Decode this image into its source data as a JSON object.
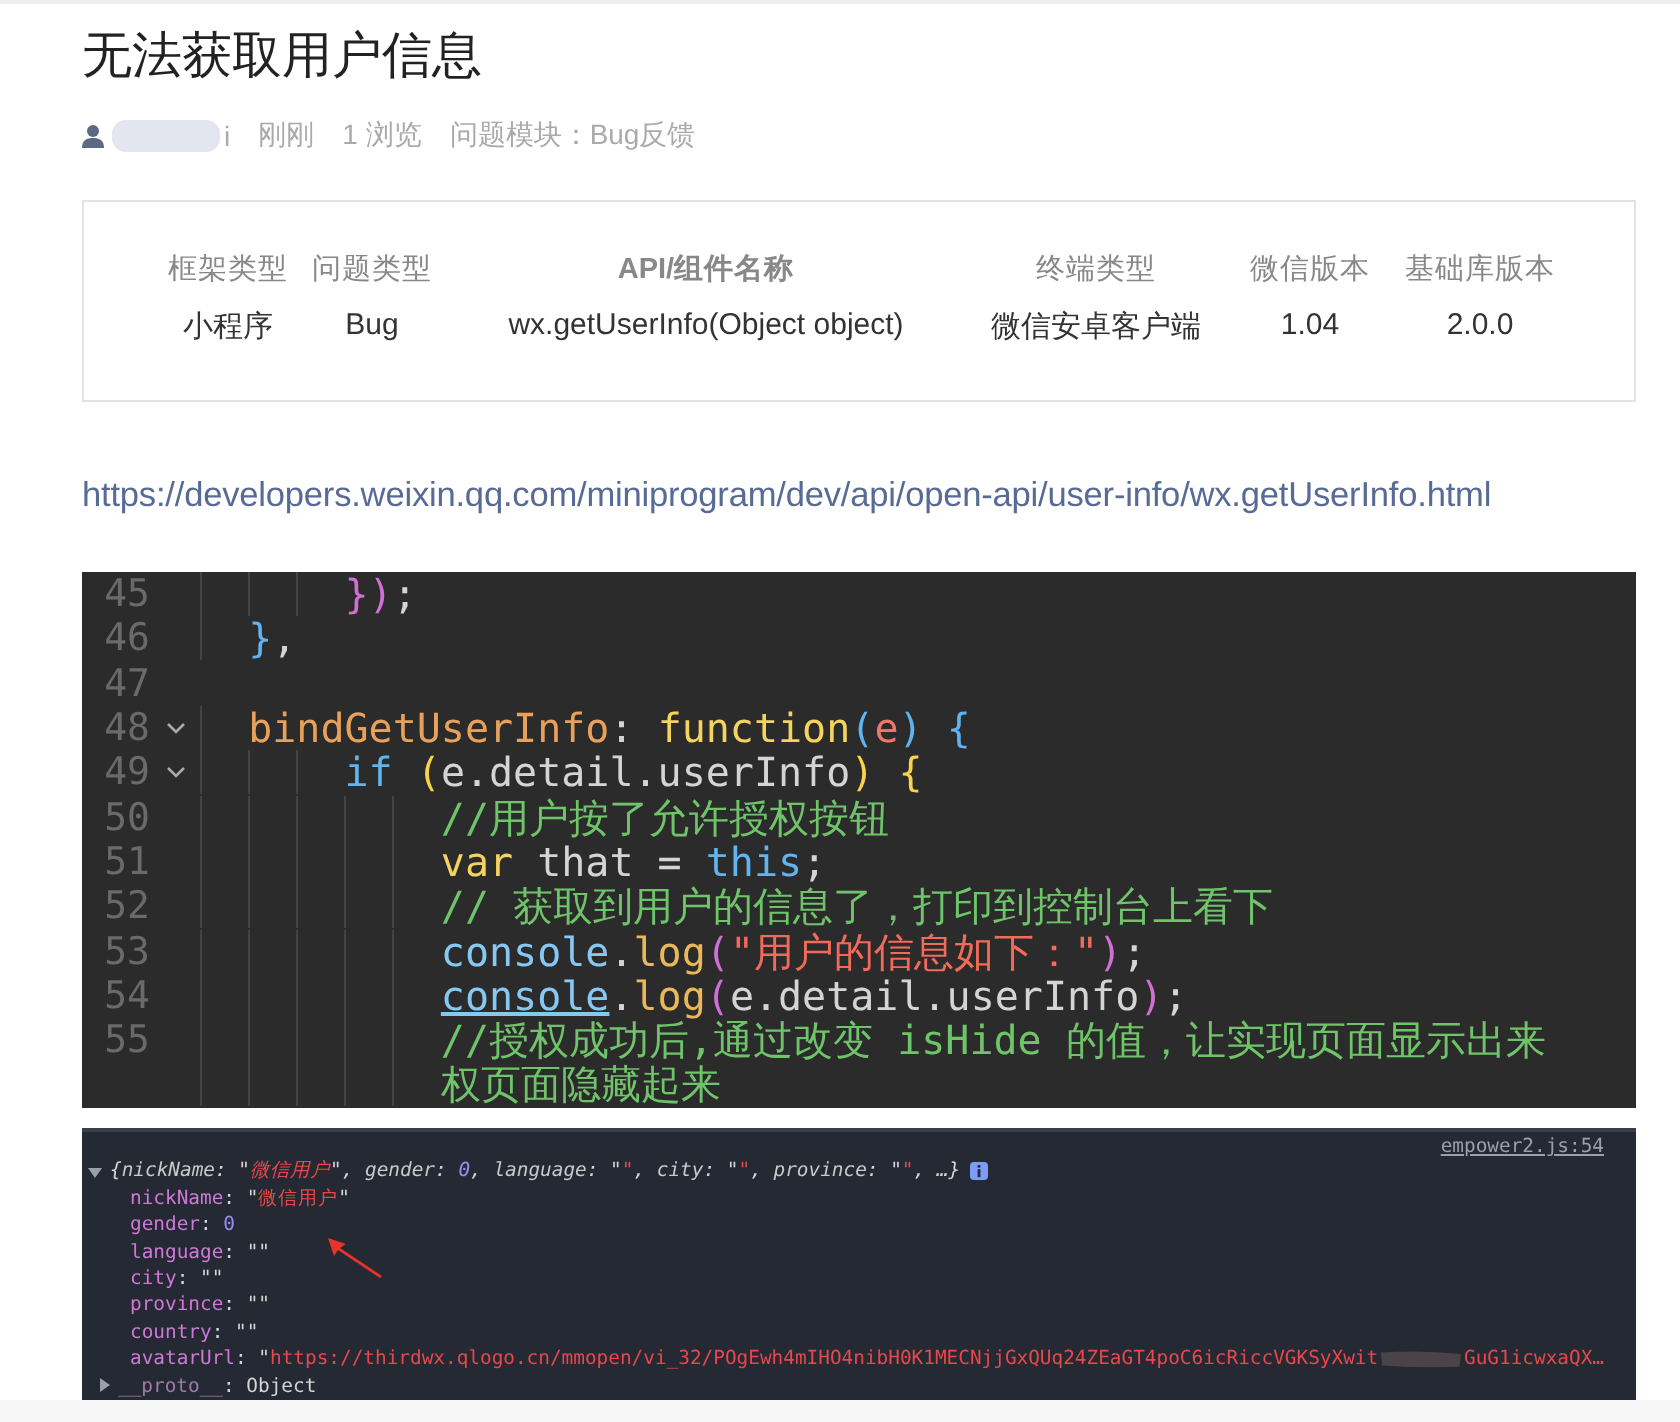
{
  "title": "无法获取用户信息",
  "meta": {
    "author": "i",
    "time": "刚刚",
    "views": "1 浏览",
    "module": "问题模块：Bug反馈"
  },
  "info_table": {
    "columns": [
      "框架类型",
      "问题类型",
      "API/组件名称",
      "终端类型",
      "微信版本",
      "基础库版本"
    ],
    "values": [
      "小程序",
      "Bug",
      "wx.getUserInfo(Object object)",
      "微信安卓客户端",
      "1.04",
      "2.0.0"
    ]
  },
  "link": "https://developers.weixin.qq.com/miniprogram/dev/api/open-api/user-info/wx.getUserInfo.html",
  "code": {
    "lines": [
      {
        "number": "45",
        "foldable": false,
        "tokens": [
          {
            "kind": "bracket3",
            "text": "      })"
          },
          {
            "kind": "plain",
            "text": ";"
          }
        ]
      },
      {
        "number": "46",
        "foldable": false,
        "tokens": [
          {
            "kind": "bracket1",
            "text": "  }"
          },
          {
            "kind": "plain",
            "text": ","
          }
        ]
      },
      {
        "number": "47",
        "foldable": false
      },
      {
        "number": "48",
        "foldable": true,
        "tokens": [
          {
            "kind": "function",
            "text": "  bindGetUserInfo"
          },
          {
            "kind": "plain",
            "text": ": "
          },
          {
            "kind": "storage",
            "text": "function"
          },
          {
            "kind": "bracket1",
            "text": "("
          },
          {
            "kind": "param",
            "text": "e"
          },
          {
            "kind": "bracket1",
            "text": ")"
          },
          {
            "kind": "bracket1",
            "text": " {"
          }
        ]
      },
      {
        "number": "49",
        "foldable": true,
        "tokens": [
          {
            "kind": "keyword",
            "text": "      if"
          },
          {
            "kind": "bracket2",
            "text": " ("
          },
          {
            "kind": "plain",
            "text": "e.detail.userInfo"
          },
          {
            "kind": "bracket2",
            "text": ")"
          },
          {
            "kind": "bracket2",
            "text": " {"
          }
        ]
      },
      {
        "number": "50",
        "foldable": false,
        "tokens": [
          {
            "kind": "comment",
            "text": "          //用户按了允许授权按钮"
          }
        ]
      },
      {
        "number": "51",
        "foldable": false,
        "tokens": [
          {
            "kind": "storage",
            "text": "          var"
          },
          {
            "kind": "plain",
            "text": " that = "
          },
          {
            "kind": "keyword",
            "text": "this"
          },
          {
            "kind": "plain",
            "text": ";"
          }
        ]
      },
      {
        "number": "52",
        "foldable": false,
        "tokens": [
          {
            "kind": "comment",
            "text": "          // 获取到用户的信息了，打印到控制台上看下"
          }
        ]
      },
      {
        "number": "53",
        "foldable": false,
        "tokens": [
          {
            "kind": "object",
            "text": "          console"
          },
          {
            "kind": "plain",
            "text": "."
          },
          {
            "kind": "method",
            "text": "log"
          },
          {
            "kind": "bracket3",
            "text": "("
          },
          {
            "kind": "string",
            "text": "\"用户的信息如下：\""
          },
          {
            "kind": "bracket3",
            "text": ")"
          },
          {
            "kind": "plain",
            "text": ";"
          }
        ]
      },
      {
        "number": "54",
        "foldable": false,
        "tokens": [
          {
            "kind": "object_link",
            "text": "          console"
          },
          {
            "kind": "plain",
            "text": "."
          },
          {
            "kind": "method",
            "text": "log"
          },
          {
            "kind": "bracket3",
            "text": "("
          },
          {
            "kind": "plain",
            "text": "e.detail.userInfo"
          },
          {
            "kind": "bracket3",
            "text": ")"
          },
          {
            "kind": "plain",
            "text": ";"
          }
        ]
      },
      {
        "number": "55",
        "foldable": false,
        "tokens": [
          {
            "kind": "comment",
            "text": "          //授权成功后,通过改变 isHide 的值，让实现页面显示出来"
          }
        ]
      },
      {
        "foldable": false,
        "tokens": [
          {
            "kind": "comment",
            "text": "          权页面隐藏起来"
          }
        ]
      }
    ]
  },
  "console": {
    "source": "empower2.js:54",
    "rows": [
      {
        "kind": "summary",
        "expanded": true,
        "tokens": [
          {
            "kind": "punct",
            "text": "{"
          },
          {
            "kind": "key",
            "text": "nickName"
          },
          {
            "kind": "punct",
            "text": ": \""
          },
          {
            "kind": "string",
            "text": "微信用户"
          },
          {
            "kind": "punct",
            "text": "\", "
          },
          {
            "kind": "key",
            "text": "gender"
          },
          {
            "kind": "punct",
            "text": ": "
          },
          {
            "kind": "number",
            "text": "0"
          },
          {
            "kind": "punct",
            "text": ", "
          },
          {
            "kind": "key",
            "text": "language"
          },
          {
            "kind": "punct",
            "text": ": \""
          },
          {
            "kind": "string",
            "text": "\""
          },
          {
            "kind": "punct",
            "text": ", "
          },
          {
            "kind": "key",
            "text": "city"
          },
          {
            "kind": "punct",
            "text": ": \""
          },
          {
            "kind": "string",
            "text": "\""
          },
          {
            "kind": "punct",
            "text": ", "
          },
          {
            "kind": "key",
            "text": "province"
          },
          {
            "kind": "punct",
            "text": ": \""
          },
          {
            "kind": "string",
            "text": "\""
          },
          {
            "kind": "punct",
            "text": ", …}"
          }
        ]
      },
      {
        "kind": "property",
        "tokens": [
          {
            "kind": "prop",
            "text": "nickName"
          },
          {
            "kind": "punct",
            "text": ": \""
          },
          {
            "kind": "string",
            "text": "微信用户"
          },
          {
            "kind": "punct",
            "text": "\""
          }
        ]
      },
      {
        "kind": "property",
        "tokens": [
          {
            "kind": "prop",
            "text": "gender"
          },
          {
            "kind": "punct",
            "text": ": "
          },
          {
            "kind": "number",
            "text": "0"
          }
        ]
      },
      {
        "kind": "property",
        "tokens": [
          {
            "kind": "prop",
            "text": "language"
          },
          {
            "kind": "punct",
            "text": ": \"\""
          }
        ]
      },
      {
        "kind": "property",
        "tokens": [
          {
            "kind": "prop",
            "text": "city"
          },
          {
            "kind": "punct",
            "text": ": \"\""
          }
        ]
      },
      {
        "kind": "property",
        "tokens": [
          {
            "kind": "prop",
            "text": "province"
          },
          {
            "kind": "punct",
            "text": ": \"\""
          }
        ]
      },
      {
        "kind": "property",
        "tokens": [
          {
            "kind": "prop",
            "text": "country"
          },
          {
            "kind": "punct",
            "text": ": \"\""
          }
        ]
      },
      {
        "kind": "property",
        "tokens": [
          {
            "kind": "prop",
            "text": "avatarUrl"
          },
          {
            "kind": "punct",
            "text": ": \""
          },
          {
            "kind": "string",
            "text": "https://thirdwx.qlogo.cn/mmopen/vi_32/POgEwh4mIHO4nibH0K1MECNjjGxQUq24ZEaGT4poC6icRiccVGKSyXwit"
          },
          {
            "kind": "redacted"
          },
          {
            "kind": "string",
            "text": "GuG1icwxaQX…"
          }
        ]
      },
      {
        "kind": "collapsed",
        "expanded": false,
        "tokens": [
          {
            "kind": "proto",
            "text": "__proto__"
          },
          {
            "kind": "punct",
            "text": ": Object"
          }
        ]
      }
    ]
  }
}
